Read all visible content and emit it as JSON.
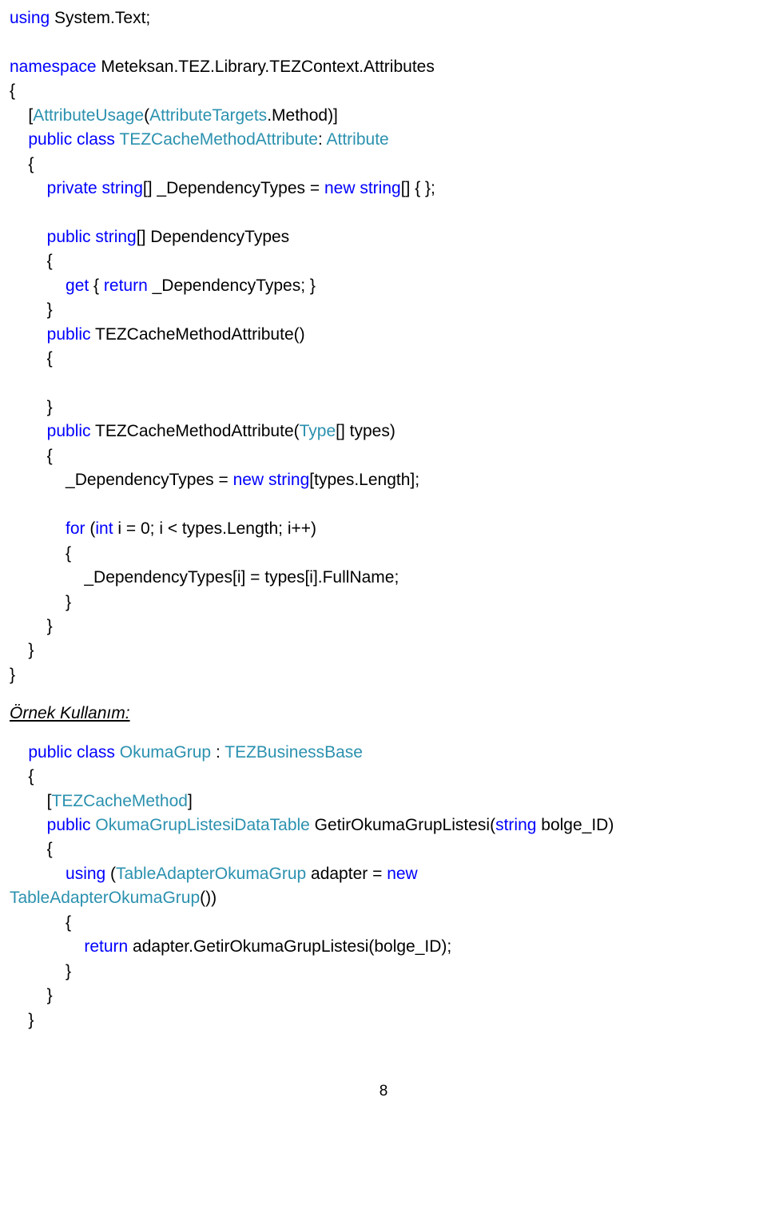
{
  "code": {
    "l1a": "using",
    "l1b": " System.Text;",
    "l2a": "namespace",
    "l2b": " Meteksan.TEZ.Library.TEZContext.Attributes",
    "l3": "{",
    "l4a": "    [",
    "l4b": "AttributeUsage",
    "l4c": "(",
    "l4d": "AttributeTargets",
    "l4e": ".Method)]",
    "l5a": "    public",
    "l5b": " class",
    "l5c": " TEZCacheMethodAttribute",
    "l5d": ": ",
    "l5e": "Attribute",
    "l6": "    {",
    "l7a": "        private",
    "l7b": " string",
    "l7c": "[] _DependencyTypes = ",
    "l7d": "new",
    "l7e": " string",
    "l7f": "[] { };",
    "l8a": "        public",
    "l8b": " string",
    "l8c": "[] DependencyTypes",
    "l9": "        {",
    "l10a": "            get",
    "l10b": " { ",
    "l10c": "return",
    "l10d": " _DependencyTypes; }",
    "l11": "        }",
    "l12a": "        public",
    "l12b": " TEZCacheMethodAttribute()",
    "l13": "        {",
    "l14": "        }",
    "l15a": "        public",
    "l15b": " TEZCacheMethodAttribute(",
    "l15c": "Type",
    "l15d": "[] types)",
    "l16": "        {",
    "l17a": "            _DependencyTypes = ",
    "l17b": "new",
    "l17c": " string",
    "l17d": "[types.Length];",
    "l18a": "            for",
    "l18b": " (",
    "l18c": "int",
    "l18d": " i = 0; i < types.Length; i++)",
    "l19": "            {",
    "l20": "                _DependencyTypes[i] = types[i].FullName;",
    "l21": "            }",
    "l22": "        }",
    "l23": "    }",
    "l24": "}",
    "exHeading": "Örnek Kullanım:",
    "e1a": "    public",
    "e1b": " class",
    "e1c": " OkumaGrup",
    "e1d": " : ",
    "e1e": "TEZBusinessBase",
    "e2": "    {",
    "e3a": "        [",
    "e3b": "TEZCacheMethod",
    "e3c": "]",
    "e4a": "        public",
    "e4b": " OkumaGrupListesiDataTable",
    "e4c": " GetirOkumaGrupListesi(",
    "e4d": "string",
    "e4e": " bolge_ID)",
    "e5": "        {",
    "e6a": "            using",
    "e6b": " (",
    "e6c": "TableAdapterOkumaGrup",
    "e6d": " adapter = ",
    "e6e": "new",
    "e7a": "TableAdapterOkumaGrup",
    "e7b": "())",
    "e8": "            {",
    "e9a": "                return",
    "e9b": " adapter.GetirOkumaGrupListesi(bolge_ID);",
    "e10": "            }",
    "e11": "        }",
    "e12": "    }"
  },
  "pageNumber": "8"
}
